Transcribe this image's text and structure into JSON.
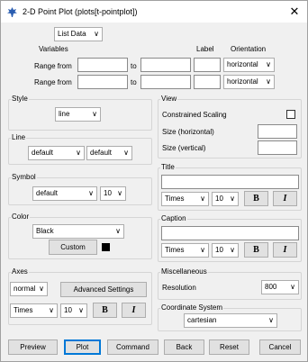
{
  "window": {
    "title": "2-D Point Plot (plots[t-pointplot])",
    "close_glyph": "✕"
  },
  "data_bar": {
    "list_data": "List Data"
  },
  "header": {
    "variables": "Variables",
    "label": "Label",
    "orientation": "Orientation"
  },
  "range_rows": [
    {
      "label": "Range from",
      "to": "to",
      "orientation": "horizontal"
    },
    {
      "label": "Range from",
      "to": "to",
      "orientation": "horizontal"
    }
  ],
  "style": {
    "title": "Style",
    "value": "line"
  },
  "line": {
    "title": "Line",
    "value1": "default",
    "value2": "default"
  },
  "symbol": {
    "title": "Symbol",
    "value": "default",
    "size": "10"
  },
  "color": {
    "title": "Color",
    "value": "Black",
    "custom": "Custom"
  },
  "axes": {
    "title": "Axes",
    "mode": "normal",
    "advanced": "Advanced Settings",
    "font": "Times",
    "size": "10",
    "bold": "B",
    "italic": "I"
  },
  "view": {
    "title": "View",
    "constrained": "Constrained Scaling",
    "size_h": "Size (horizontal)",
    "size_v": "Size (vertical)"
  },
  "title_group": {
    "title": "Title",
    "font": "Times",
    "size": "10",
    "bold": "B",
    "italic": "I"
  },
  "caption": {
    "title": "Caption",
    "font": "Times",
    "size": "10",
    "bold": "B",
    "italic": "I"
  },
  "misc": {
    "title": "Miscellaneous",
    "resolution": "Resolution",
    "resolution_value": "800"
  },
  "coord": {
    "title": "Coordinate System",
    "value": "cartesian"
  },
  "footer": {
    "preview": "Preview",
    "plot": "Plot",
    "command": "Command",
    "back": "Back",
    "reset": "Reset",
    "cancel": "Cancel"
  },
  "colors": {
    "accent": "#0078d7",
    "window_bg": "#f0f0f0"
  }
}
